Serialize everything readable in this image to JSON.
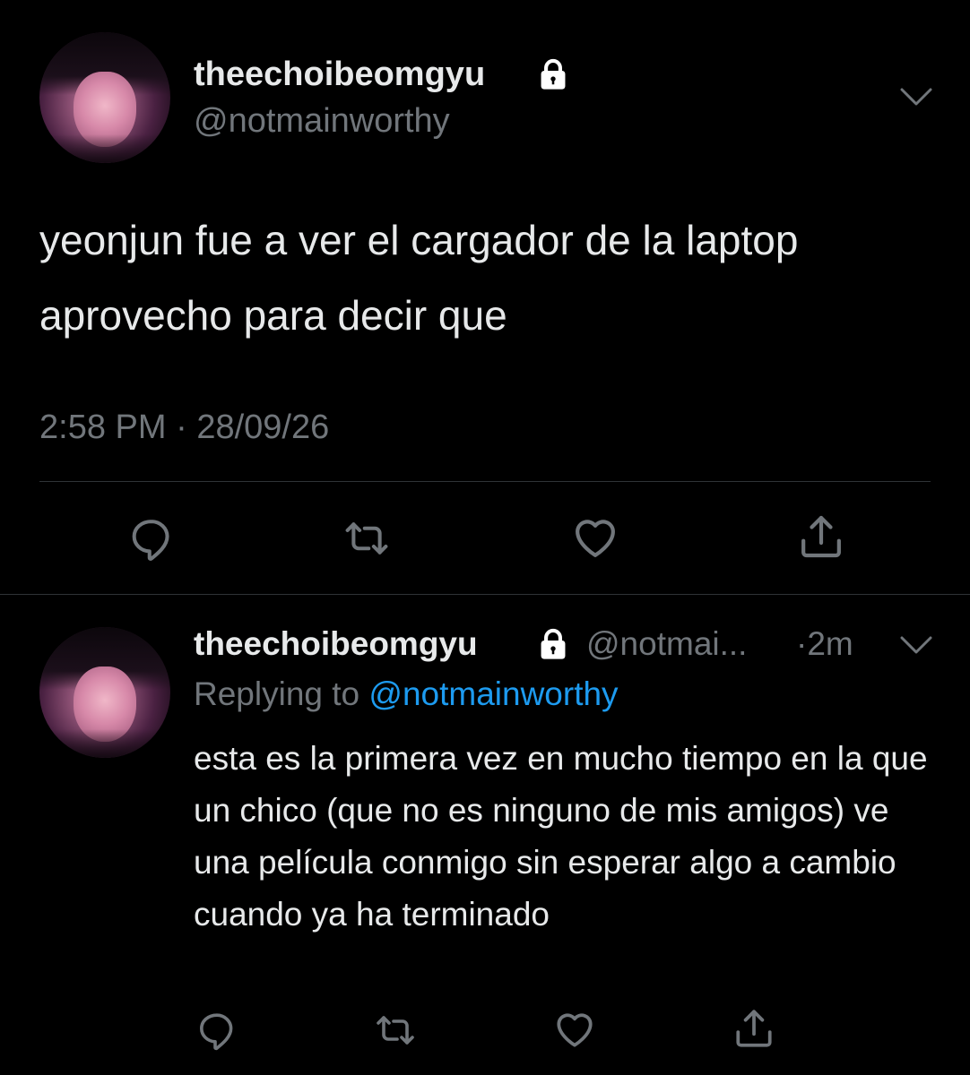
{
  "main_tweet": {
    "display_name": "theechoibeomgyu",
    "handle": "@notmainworthy",
    "text": "yeonjun fue a ver el cargador de la laptop aprovecho para decir que",
    "time": "2:58 PM",
    "separator": "·",
    "date": "28/09/26"
  },
  "reply_tweet": {
    "display_name": "theechoibeomgyu",
    "handle": "@notmai...",
    "time_ago": "·2m",
    "replying_to_label": "Replying to",
    "replying_to_handle": "@notmainworthy",
    "text": "esta es la primera vez en mucho tiempo en la que un chico (que no es ninguno de mis amigos) ve una película conmigo sin esperar algo a cambio cuando ya ha terminado"
  },
  "icons": {
    "lock": "lock-icon",
    "chevron": "chevron-down-icon",
    "reply": "reply-icon",
    "retweet": "retweet-icon",
    "like": "heart-icon",
    "share": "share-icon"
  },
  "colors": {
    "background": "#000000",
    "text": "#e7e9ea",
    "secondary": "#71767b",
    "link": "#1d9bf0",
    "divider": "#2f3336"
  }
}
